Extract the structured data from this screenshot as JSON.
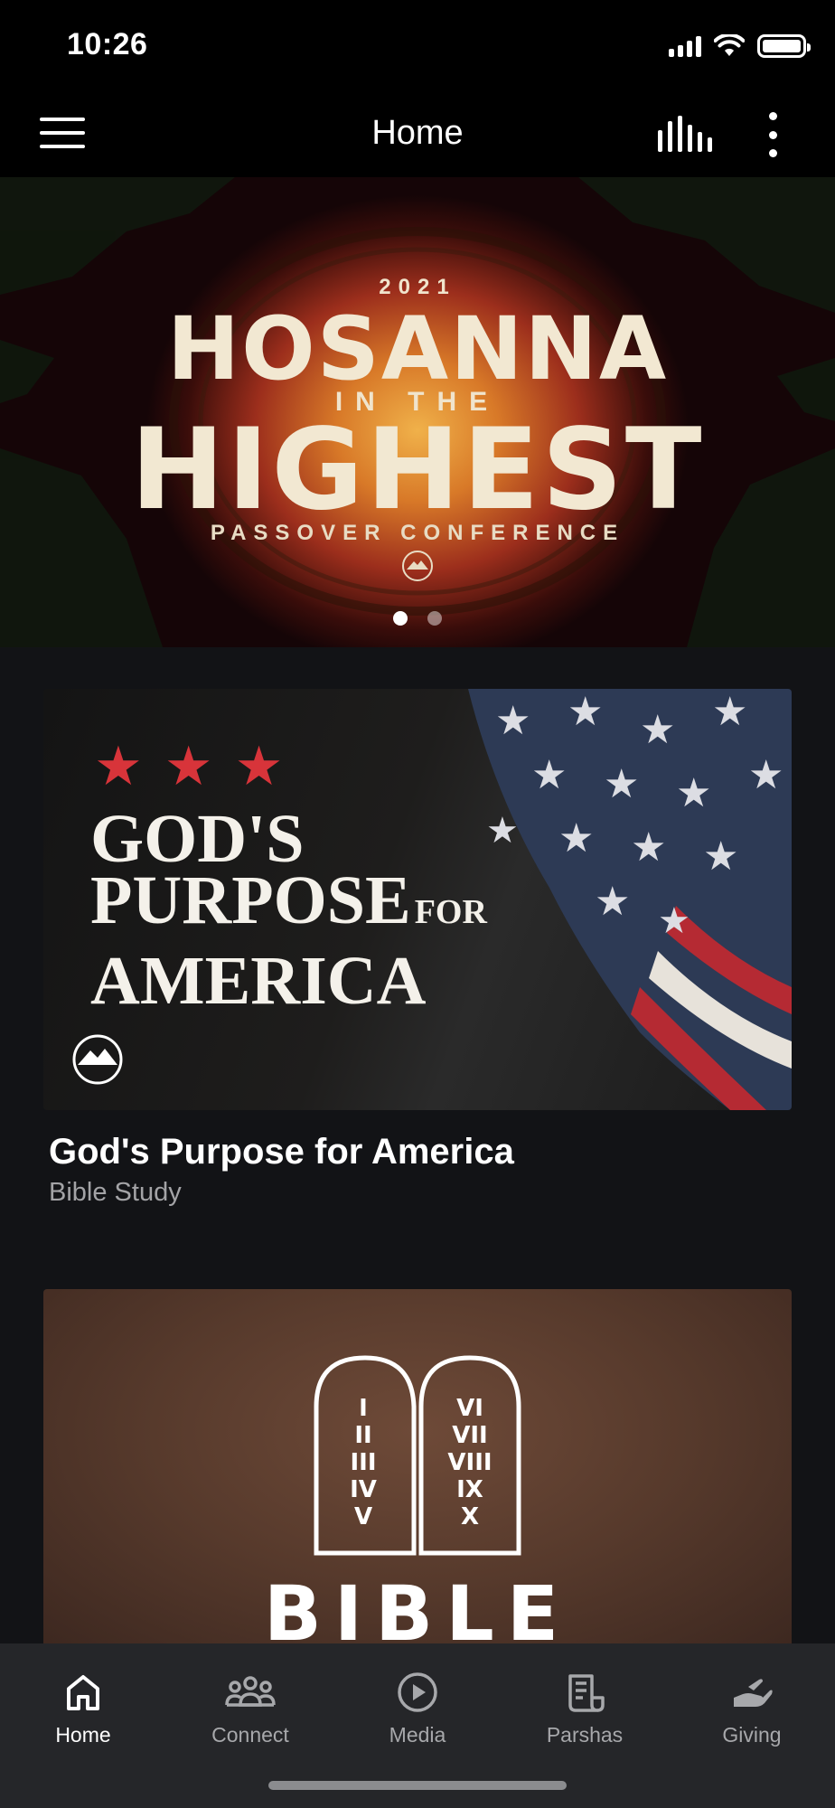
{
  "status_bar": {
    "time": "10:26",
    "icons": [
      "cellular-signal-icon",
      "wifi-icon",
      "battery-icon"
    ]
  },
  "app_bar": {
    "title": "Home",
    "icons": [
      "hamburger-menu-icon",
      "audio-bars-icon",
      "more-vertical-icon"
    ]
  },
  "hero": {
    "year": "2021",
    "line1": "HOSANNA",
    "line2": "IN THE",
    "line3": "HIGHEST",
    "subtitle": "PASSOVER CONFERENCE",
    "slide_count": 2,
    "active_slide": 1
  },
  "cards": [
    {
      "image_text": {
        "line1": "GOD'S",
        "line2": "PURPOSE",
        "line2b": "FOR",
        "line3": "AMERICA"
      },
      "title": "God's Purpose for America",
      "subtitle": "Bible Study"
    },
    {
      "image_text": {
        "word": "BIBLE",
        "left_numerals": [
          "I",
          "II",
          "III",
          "IV",
          "V"
        ],
        "right_numerals": [
          "VI",
          "VII",
          "VIII",
          "IX",
          "X"
        ]
      }
    }
  ],
  "bottom_nav": [
    {
      "label": "Home",
      "icon": "home-icon",
      "active": true
    },
    {
      "label": "Connect",
      "icon": "people-group-icon",
      "active": false
    },
    {
      "label": "Media",
      "icon": "play-circle-icon",
      "active": false
    },
    {
      "label": "Parshas",
      "icon": "scroll-icon",
      "active": false
    },
    {
      "label": "Giving",
      "icon": "giving-hand-icon",
      "active": false
    }
  ],
  "colors": {
    "background": "#121316",
    "nav_background": "#252629",
    "inactive_text": "#a7a8ab",
    "star_red": "#d8343a"
  }
}
